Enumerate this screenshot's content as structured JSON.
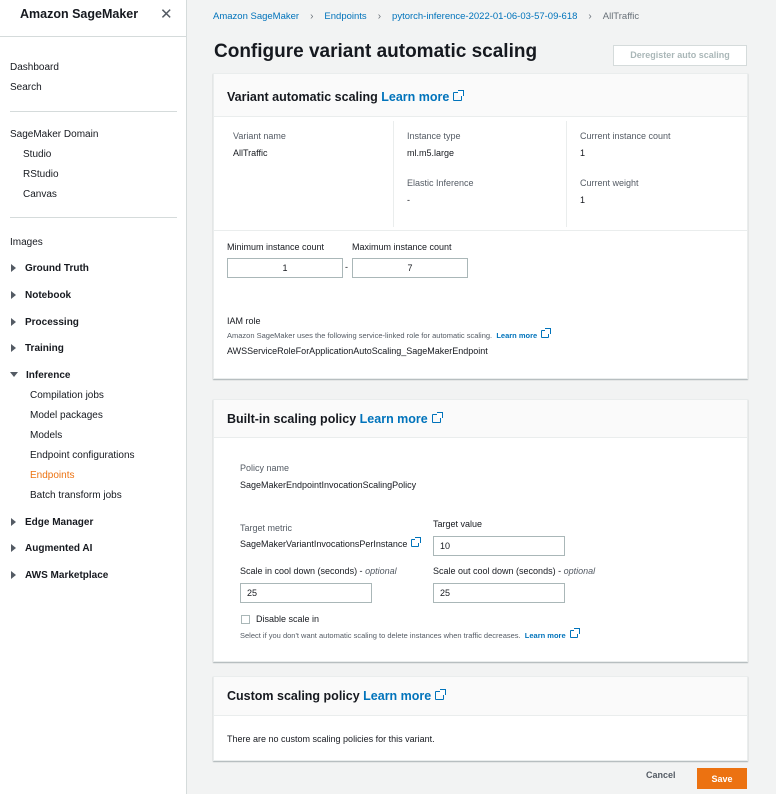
{
  "sidebar": {
    "title": "Amazon SageMaker",
    "close_icon": "close-icon",
    "top_links": [
      "Dashboard",
      "Search"
    ],
    "domain_header": "SageMaker Domain",
    "domain_items": [
      "Studio",
      "RStudio",
      "Canvas"
    ],
    "images": "Images",
    "groups": {
      "ground_truth": "Ground Truth",
      "notebook": "Notebook",
      "processing": "Processing",
      "training": "Training",
      "inference": "Inference",
      "edge_manager": "Edge Manager",
      "augmented_ai": "Augmented AI",
      "aws_marketplace": "AWS Marketplace"
    },
    "inference_items": [
      "Compilation jobs",
      "Model packages",
      "Models",
      "Endpoint configurations",
      "Endpoints",
      "Batch transform jobs"
    ],
    "active_item": "Endpoints"
  },
  "breadcrumb": [
    "Amazon SageMaker",
    "Endpoints",
    "pytorch-inference-2022-01-06-03-57-09-618",
    "AllTraffic"
  ],
  "page": {
    "title": "Configure variant automatic scaling",
    "deregister_label": "Deregister auto scaling"
  },
  "variant": {
    "title": "Variant automatic scaling",
    "learn_more": "Learn more",
    "variant_name_label": "Variant name",
    "variant_name": "AllTraffic",
    "instance_type_label": "Instance type",
    "instance_type": "ml.m5.large",
    "elastic_inference_label": "Elastic Inference",
    "elastic_inference": "-",
    "current_count_label": "Current instance count",
    "current_count": "1",
    "current_weight_label": "Current weight",
    "current_weight": "1",
    "min_label": "Minimum instance count",
    "min_value": "1",
    "range_sep": "-",
    "max_label": "Maximum instance count",
    "max_value": "7",
    "iam_label": "IAM role",
    "iam_desc": "Amazon SageMaker uses the following service-linked role for automatic scaling.",
    "iam_learn_more": "Learn more",
    "iam_role": "AWSServiceRoleForApplicationAutoScaling_SageMakerEndpoint"
  },
  "builtin": {
    "title": "Built-in scaling policy",
    "learn_more": "Learn more",
    "policy_name_label": "Policy name",
    "policy_name": "SageMakerEndpointInvocationScalingPolicy",
    "target_metric_label": "Target metric",
    "target_metric": "SageMakerVariantInvocationsPerInstance",
    "target_value_label": "Target value",
    "target_value": "10",
    "scale_in_label": "Scale in cool down (seconds) - ",
    "scale_out_label": "Scale out cool down (seconds) - ",
    "optional": "optional",
    "scale_in_value": "25",
    "scale_out_value": "25",
    "disable_label": "Disable scale in",
    "disable_desc": "Select if you don't want automatic scaling to delete instances when traffic decreases.",
    "disable_learn_more": "Learn more"
  },
  "custom": {
    "title": "Custom scaling policy",
    "learn_more": "Learn more",
    "empty": "There are no custom scaling policies for this variant."
  },
  "footer": {
    "cancel": "Cancel",
    "save": "Save"
  },
  "colors": {
    "link": "#0073bb",
    "primary": "#ec7211",
    "active_nav": "#ec7211"
  }
}
